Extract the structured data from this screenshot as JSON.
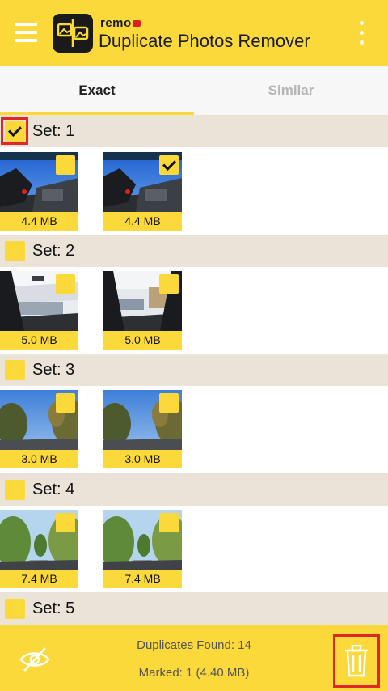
{
  "app": {
    "brand": "remo",
    "title": "Duplicate Photos Remover"
  },
  "tabs": [
    {
      "label": "Exact",
      "active": true
    },
    {
      "label": "Similar",
      "active": false
    }
  ],
  "sets": [
    {
      "title": "Set: 1",
      "checked": true,
      "photos": [
        {
          "size": "4.4 MB",
          "checked": false,
          "scene": "car-interior"
        },
        {
          "size": "4.4 MB",
          "checked": true,
          "scene": "car-interior"
        }
      ]
    },
    {
      "title": "Set: 2",
      "checked": false,
      "photos": [
        {
          "size": "5.0 MB",
          "checked": false,
          "scene": "car-windshield"
        },
        {
          "size": "5.0 MB",
          "checked": false,
          "scene": "car-windshield"
        }
      ]
    },
    {
      "title": "Set: 3",
      "checked": false,
      "photos": [
        {
          "size": "3.0 MB",
          "checked": false,
          "scene": "road-trees"
        },
        {
          "size": "3.0 MB",
          "checked": false,
          "scene": "road-trees"
        }
      ]
    },
    {
      "title": "Set: 4",
      "checked": false,
      "photos": [
        {
          "size": "7.4 MB",
          "checked": false,
          "scene": "road-green"
        },
        {
          "size": "7.4 MB",
          "checked": false,
          "scene": "road-green"
        }
      ]
    },
    {
      "title": "Set: 5",
      "checked": false,
      "photos": []
    }
  ],
  "footer": {
    "duplicates_found": "Duplicates Found: 14",
    "marked": "Marked: 1 (4.40 MB)"
  },
  "colors": {
    "accent": "#fcd93a",
    "set_header_bg": "#ebe3d8",
    "highlight": "#e0262a"
  },
  "icons": {
    "menu": "hamburger-menu-icon",
    "more": "kebab-more-icon",
    "hide": "eye-slash-icon",
    "delete": "trash-icon"
  }
}
